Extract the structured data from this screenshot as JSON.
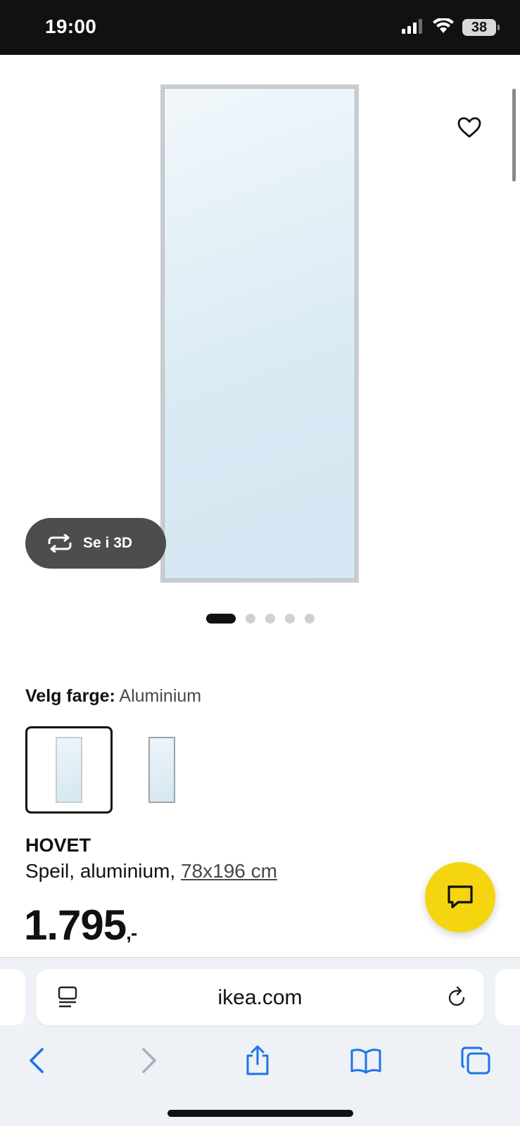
{
  "status_bar": {
    "time": "19:00",
    "battery": "38",
    "icons": [
      "cellular-signal-icon",
      "wifi-icon",
      "battery-icon"
    ]
  },
  "gallery": {
    "view_3d_label": "Se i 3D",
    "page_count": 5,
    "active_page": 1
  },
  "color_selection": {
    "label": "Velg farge:",
    "selected_value": "Aluminium",
    "options_count": 2,
    "selected_index": 0
  },
  "product": {
    "name": "HOVET",
    "description": "Speil, aluminium, ",
    "size": "78x196 cm",
    "price": "1.795",
    "price_suffix": ",-"
  },
  "browser": {
    "url": "ikea.com",
    "toolbar": [
      "back-icon",
      "forward-icon",
      "share-icon",
      "bookmarks-icon",
      "tabs-icon"
    ]
  },
  "colors": {
    "status_bar_bg": "#111111",
    "chat_button": "#f5d510",
    "view_3d_button": "#4d4d4d",
    "link_blue": "#1e73e6"
  }
}
